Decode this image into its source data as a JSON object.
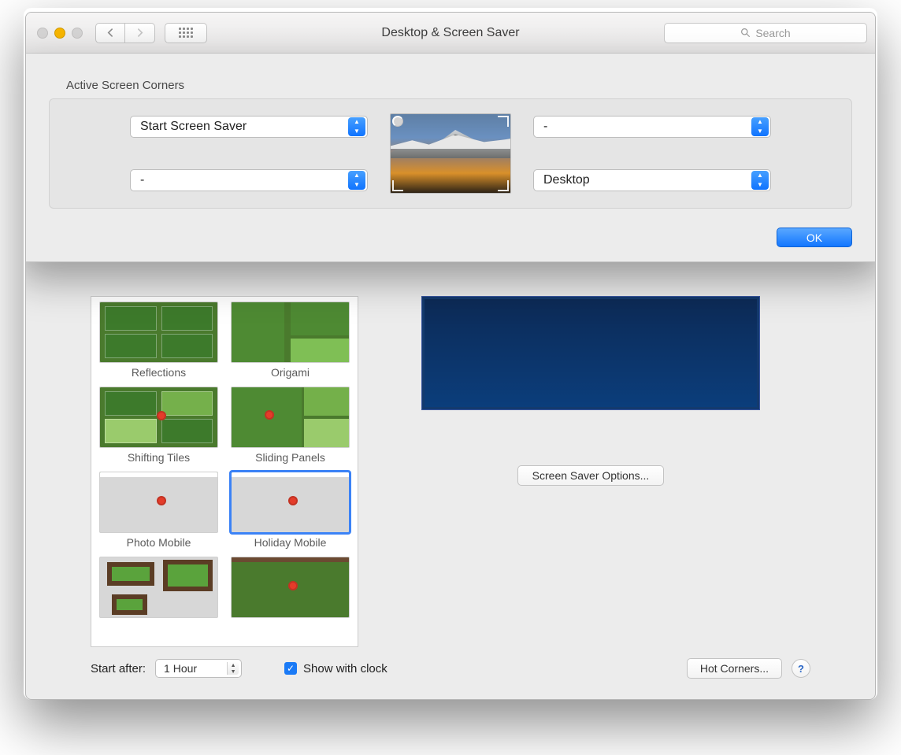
{
  "window": {
    "title": "Desktop & Screen Saver",
    "search_placeholder": "Search"
  },
  "sheet": {
    "title": "Active Screen Corners",
    "corners": {
      "top_left": "Start Screen Saver",
      "top_right": "-",
      "bottom_left": "-",
      "bottom_right": "Desktop"
    },
    "ok_label": "OK"
  },
  "screensavers": {
    "items": [
      {
        "label": "Reflections"
      },
      {
        "label": "Origami"
      },
      {
        "label": "Shifting Tiles"
      },
      {
        "label": "Sliding Panels"
      },
      {
        "label": "Photo Mobile"
      },
      {
        "label": "Holiday Mobile"
      }
    ],
    "options_label": "Screen Saver Options..."
  },
  "bottom": {
    "start_after_label": "Start after:",
    "start_after_value": "1 Hour",
    "show_clock_label": "Show with clock",
    "show_clock_checked": true,
    "hot_corners_label": "Hot Corners...",
    "help_label": "?"
  }
}
